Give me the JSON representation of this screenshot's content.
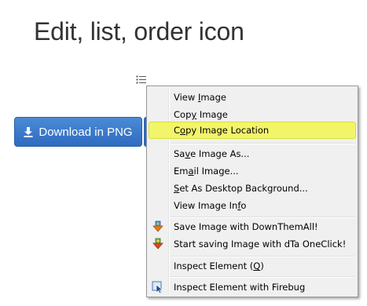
{
  "page": {
    "title": "Edit, list, order icon"
  },
  "download_button": {
    "label": "Download in PNG",
    "icon": "download-icon"
  },
  "list_icon": {
    "icon": "ordered-list-icon"
  },
  "context_menu": {
    "highlight_color": "#f2f56a",
    "items": [
      {
        "pre": "View ",
        "key": "I",
        "post": "mage",
        "highlighted": false
      },
      {
        "pre": "Cop",
        "key": "y",
        "post": " Image",
        "highlighted": false
      },
      {
        "pre": "C",
        "key": "o",
        "post": "py Image Location",
        "highlighted": true
      },
      {
        "pre": "Sa",
        "key": "v",
        "post": "e Image As...",
        "highlighted": false
      },
      {
        "pre": "Em",
        "key": "a",
        "post": "il Image...",
        "highlighted": false
      },
      {
        "pre": "",
        "key": "S",
        "post": "et As Desktop Background...",
        "highlighted": false
      },
      {
        "pre": "View Image In",
        "key": "f",
        "post": "o",
        "highlighted": false
      },
      {
        "pre": "Save Image with DownThemAll!",
        "key": "",
        "post": "",
        "highlighted": false,
        "icon": "downthemall-icon"
      },
      {
        "pre": "Start saving Image with dTa OneClick!",
        "key": "",
        "post": "",
        "highlighted": false,
        "icon": "dta-oneclick-icon"
      },
      {
        "pre": "Inspect Element (",
        "key": "Q",
        "post": ")",
        "highlighted": false
      },
      {
        "pre": "Inspect Element with Firebug",
        "key": "",
        "post": "",
        "highlighted": false,
        "icon": "firebug-inspect-icon"
      }
    ]
  }
}
